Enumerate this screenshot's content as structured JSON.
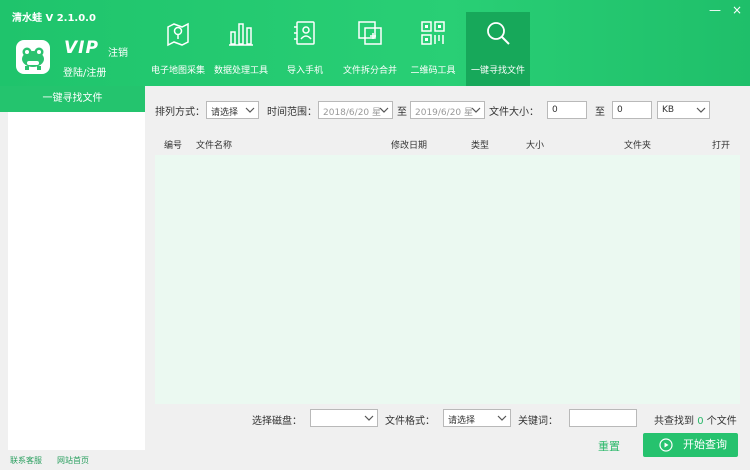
{
  "app": {
    "title": "清水蛙  V 2.1.0.0"
  },
  "window_controls": {
    "minimize": "—",
    "close": "×"
  },
  "account": {
    "vip": "VIP",
    "logout": "注销",
    "login": "登陆/注册"
  },
  "nav": [
    {
      "label": "电子地图采集",
      "icon": "map-pin-icon"
    },
    {
      "label": "数据处理工具",
      "icon": "bar-chart-icon"
    },
    {
      "label": "导入手机",
      "icon": "contact-card-icon"
    },
    {
      "label": "文件拆分合并",
      "icon": "split-merge-icon"
    },
    {
      "label": "二维码工具",
      "icon": "qr-code-icon"
    },
    {
      "label": "一键寻找文件",
      "icon": "search-icon"
    }
  ],
  "sidebar": {
    "title": "一键寻找文件"
  },
  "footer": {
    "support": "联系客服",
    "website": "网站首页"
  },
  "filters": {
    "sort_label": "排列方式：",
    "sort_value": "请选择",
    "time_label": "时间范围：",
    "time_from": "2018/6/20 星",
    "time_to_label": "至",
    "time_to": "2019/6/20 星",
    "size_label": "文件大小：",
    "size_min": "0",
    "size_to_label": "至",
    "size_max": "0",
    "size_unit": "KB"
  },
  "table": {
    "columns": [
      "编号",
      "文件名称",
      "修改日期",
      "类型",
      "大小",
      "文件夹",
      "打开"
    ]
  },
  "bottom": {
    "disk_label": "选择磁盘：",
    "disk_value": "",
    "format_label": "文件格式：",
    "format_value": "请选择",
    "keyword_label": "关键词：",
    "keyword_value": "",
    "result_prefix": "共查找到",
    "result_count": "0",
    "result_suffix": "个文件"
  },
  "actions": {
    "reset": "重置",
    "search": "开始查询"
  },
  "colors": {
    "brand_green": "#26c26e",
    "active_nav": "#17a85a",
    "table_bg": "#ebf9f1"
  }
}
